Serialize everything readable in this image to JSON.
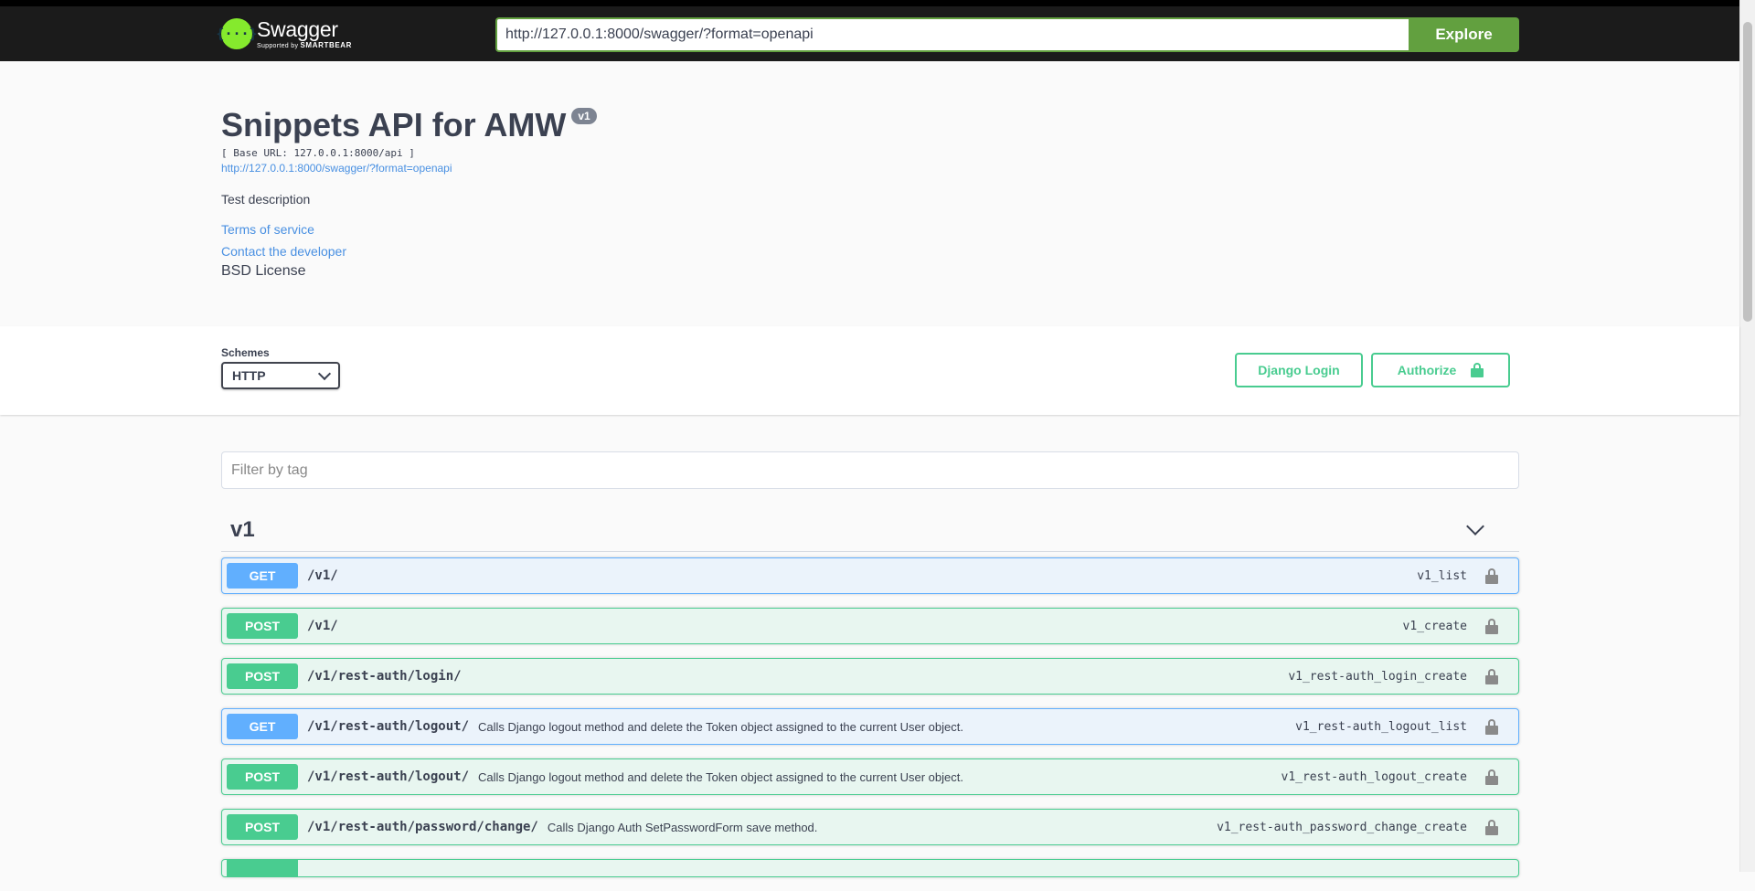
{
  "topbar": {
    "logo_title": "Swagger",
    "logo_supported_by": "Supported by",
    "logo_brand": "SMARTBEAR",
    "url_value": "http://127.0.0.1:8000/swagger/?format=openapi",
    "explore_label": "Explore"
  },
  "info": {
    "title": "Snippets API for AMW",
    "version": "v1",
    "base_url": "[ Base URL: 127.0.0.1:8000/api ]",
    "spec_link": "http://127.0.0.1:8000/swagger/?format=openapi",
    "description": "Test description",
    "terms": "Terms of service",
    "contact": "Contact the developer",
    "license": "BSD License"
  },
  "schemes": {
    "label": "Schemes",
    "selected": "HTTP",
    "login_label": "Django Login",
    "authorize_label": "Authorize"
  },
  "filter": {
    "placeholder": "Filter by tag"
  },
  "tag": {
    "name": "v1"
  },
  "operations": [
    {
      "method": "GET",
      "path": "/v1/",
      "description": "",
      "operation_id": "v1_list"
    },
    {
      "method": "POST",
      "path": "/v1/",
      "description": "",
      "operation_id": "v1_create"
    },
    {
      "method": "POST",
      "path": "/v1/rest-auth/login/",
      "description": "",
      "operation_id": "v1_rest-auth_login_create"
    },
    {
      "method": "GET",
      "path": "/v1/rest-auth/logout/",
      "description": "Calls Django logout method and delete the Token object assigned to the current User object.",
      "operation_id": "v1_rest-auth_logout_list"
    },
    {
      "method": "POST",
      "path": "/v1/rest-auth/logout/",
      "description": "Calls Django logout method and delete the Token object assigned to the current User object.",
      "operation_id": "v1_rest-auth_logout_create"
    },
    {
      "method": "POST",
      "path": "/v1/rest-auth/password/change/",
      "description": "Calls Django Auth SetPasswordForm save method.",
      "operation_id": "v1_rest-auth_password_change_create"
    }
  ],
  "colors": {
    "get": "#61affe",
    "post": "#49cc90",
    "explore": "#62a03f"
  }
}
